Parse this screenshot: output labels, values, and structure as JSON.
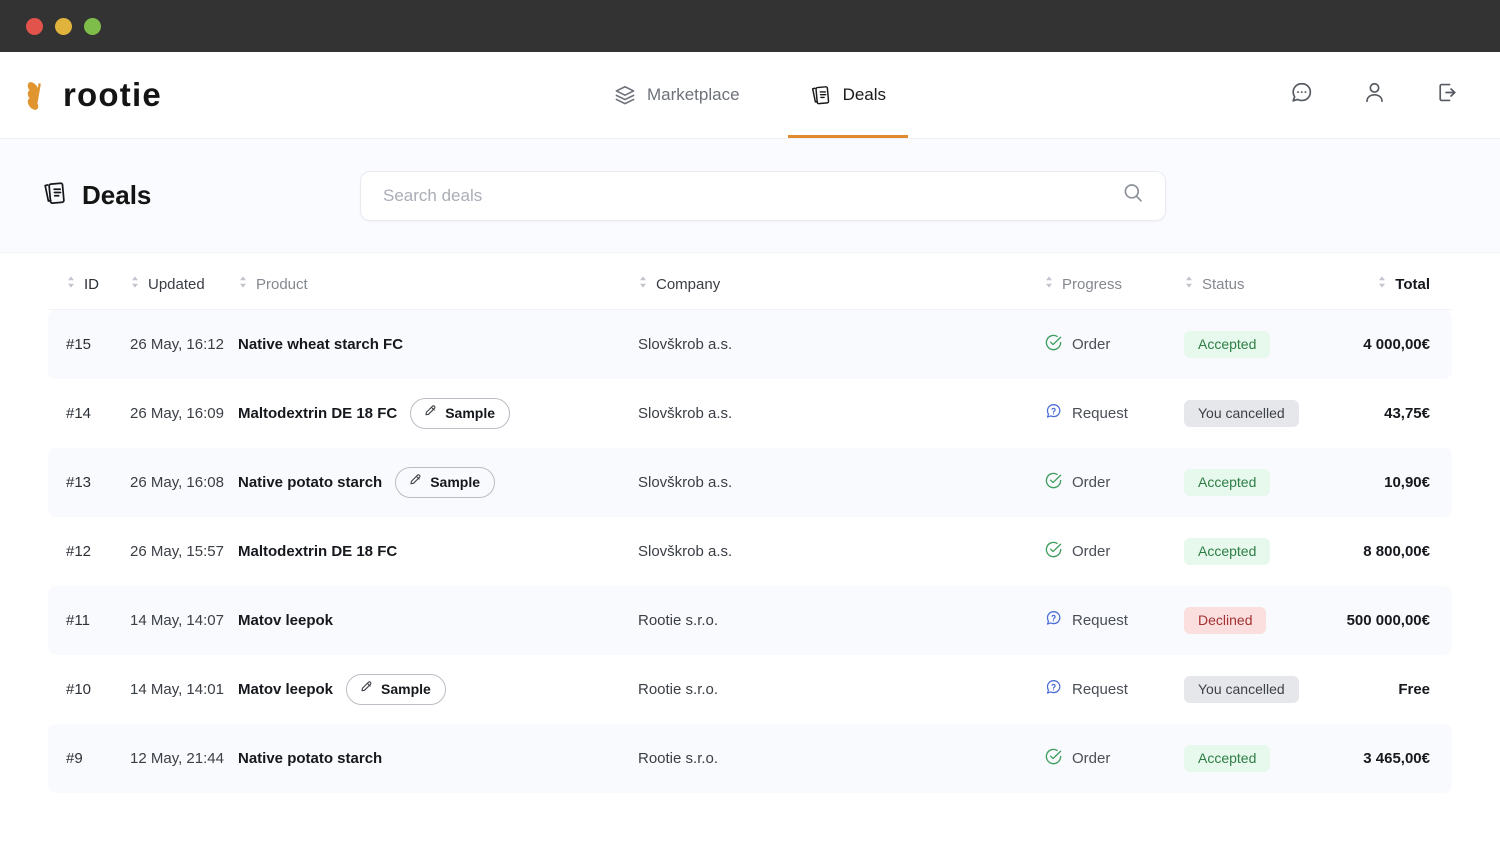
{
  "window": {
    "traffic_lights": [
      "close",
      "minimize",
      "maximize"
    ],
    "colors": {
      "close": "#e2534c",
      "minimize": "#e0b33c",
      "maximize": "#7fbd4a",
      "titlebar": "#333333"
    }
  },
  "brand": {
    "name": "rootie",
    "accent": "#e08b2e"
  },
  "nav": {
    "items": [
      {
        "label": "Marketplace",
        "icon": "layers-icon",
        "active": false
      },
      {
        "label": "Deals",
        "icon": "documents-icon",
        "active": true
      }
    ],
    "actions": [
      {
        "name": "messages-icon"
      },
      {
        "name": "user-icon"
      },
      {
        "name": "logout-icon"
      }
    ]
  },
  "page": {
    "title": "Deals",
    "title_icon": "documents-icon"
  },
  "search": {
    "placeholder": "Search deals",
    "value": "",
    "icon": "search-icon"
  },
  "table": {
    "columns": [
      {
        "key": "id",
        "label": "ID",
        "sortable": true,
        "align": "left"
      },
      {
        "key": "updated",
        "label": "Updated",
        "sortable": true,
        "align": "left"
      },
      {
        "key": "product",
        "label": "Product",
        "sortable": true,
        "align": "left"
      },
      {
        "key": "company",
        "label": "Company",
        "sortable": true,
        "align": "left"
      },
      {
        "key": "progress",
        "label": "Progress",
        "sortable": true,
        "align": "left"
      },
      {
        "key": "status",
        "label": "Status",
        "sortable": true,
        "align": "left"
      },
      {
        "key": "total",
        "label": "Total",
        "sortable": true,
        "align": "right"
      }
    ],
    "rows": [
      {
        "id": "#15",
        "updated": "26 May, 16:12",
        "product": "Native wheat starch FC",
        "sample": false,
        "company": "Slovškrob a.s.",
        "progress": "Order",
        "progress_icon": "check-circle-icon",
        "status": "Accepted",
        "status_kind": "accepted",
        "total": "4 000,00€"
      },
      {
        "id": "#14",
        "updated": "26 May, 16:09",
        "product": "Maltodextrin DE 18 FC",
        "sample": true,
        "sample_label": "Sample",
        "company": "Slovškrob a.s.",
        "progress": "Request",
        "progress_icon": "request-bubble-icon",
        "status": "You cancelled",
        "status_kind": "cancelled",
        "total": "43,75€"
      },
      {
        "id": "#13",
        "updated": "26 May, 16:08",
        "product": "Native potato starch",
        "sample": true,
        "sample_label": "Sample",
        "company": "Slovškrob a.s.",
        "progress": "Order",
        "progress_icon": "check-circle-icon",
        "status": "Accepted",
        "status_kind": "accepted",
        "total": "10,90€"
      },
      {
        "id": "#12",
        "updated": "26 May, 15:57",
        "product": "Maltodextrin DE 18 FC",
        "sample": false,
        "company": "Slovškrob a.s.",
        "progress": "Order",
        "progress_icon": "check-circle-icon",
        "status": "Accepted",
        "status_kind": "accepted",
        "total": "8 800,00€"
      },
      {
        "id": "#11",
        "updated": "14 May, 14:07",
        "product": "Matov leepok",
        "sample": false,
        "company": "Rootie s.r.o.",
        "progress": "Request",
        "progress_icon": "request-bubble-icon",
        "status": "Declined",
        "status_kind": "declined",
        "total": "500 000,00€"
      },
      {
        "id": "#10",
        "updated": "14 May, 14:01",
        "product": "Matov leepok",
        "sample": true,
        "sample_label": "Sample",
        "company": "Rootie s.r.o.",
        "progress": "Request",
        "progress_icon": "request-bubble-icon",
        "status": "You cancelled",
        "status_kind": "cancelled",
        "total": "Free"
      },
      {
        "id": "#9",
        "updated": "12 May, 21:44",
        "product": "Native potato starch",
        "sample": false,
        "company": "Rootie s.r.o.",
        "progress": "Order",
        "progress_icon": "check-circle-icon",
        "status": "Accepted",
        "status_kind": "accepted",
        "total": "3 465,00€"
      }
    ]
  },
  "colors": {
    "accent": "#e08b2e",
    "accepted_bg": "#e6f9ec",
    "accepted_fg": "#2f7d46",
    "cancelled_bg": "#e6e7ea",
    "cancelled_fg": "#3c4048",
    "declined_bg": "#fbdfdf",
    "declined_fg": "#a33232",
    "order_icon": "#3f9d5e",
    "request_icon": "#4c6fd6",
    "row_stripe": "#f9fafd"
  }
}
